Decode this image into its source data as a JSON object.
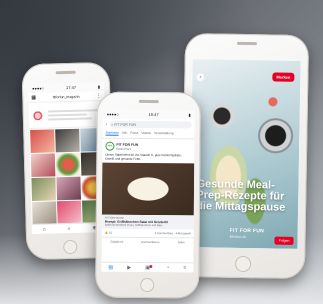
{
  "phone_left": {
    "status": {
      "carrier": "●●●●○",
      "time": "17:47",
      "battery": "▮"
    },
    "header": {
      "username": "fitforfun_magazin"
    },
    "tabbar": {
      "home_icon": "⌂",
      "search_icon": "⌕",
      "add_icon": "⊕"
    }
  },
  "phone_center": {
    "status": {
      "carrier": "●●●●○",
      "time": "15:47",
      "battery": "▮"
    },
    "search": {
      "back_icon": "‹",
      "query": "FIT FOR FUN"
    },
    "tabs": [
      "Startseite",
      "Info",
      "Fotos",
      "Videos",
      "Veranstaltung"
    ],
    "post": {
      "page_name": "FIT FOR FUN",
      "meta": "Gesponsert",
      "text": "Dieser Salat liefert dir viel Vitamin C, gute Kohlenhydrate, Eiweiß und gesunde Fette.",
      "link_domain": "FITFORFUN.DE",
      "link_title": "Rezept: Grillhähnchen-Salat mit Grünkohl",
      "link_sub": "Salat mit Grünkohl-Pesto, Grillhähnchen und Mais",
      "likes": "52",
      "comments": "2 Kommentare · 4 Mal geteilt",
      "actions": [
        "Gefällt mir",
        "Kommentieren",
        "Teilen"
      ]
    },
    "bottom_icons": [
      "▤",
      "▶",
      "▣",
      "◔",
      "≡"
    ]
  },
  "phone_right": {
    "status": {
      "time": "9:41"
    },
    "back_icon": "‹",
    "save_button": "Merken",
    "title": "Gesunde Meal-Prep-Rezepte für die Mittagspause",
    "brand": "FIT FOR FUN",
    "url": "fitforfun.de",
    "follow_button": "Folgen"
  },
  "colors": {
    "facebook_blue": "#1877f2",
    "pinterest_red": "#e60023"
  }
}
